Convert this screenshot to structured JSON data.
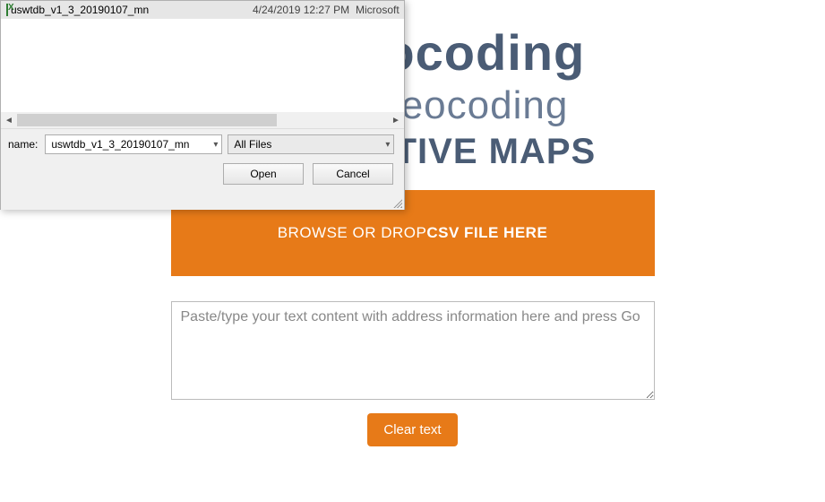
{
  "page": {
    "title": "ch Geocoding",
    "subtitle": "verse Geocoding",
    "tagline": "INTERACTIVE MAPS",
    "dropzone_prefix": "BROWSE OR DROP ",
    "dropzone_bold": "CSV FILE HERE",
    "textarea_placeholder": "Paste/type your text content with address information here and press Go",
    "clear_label": "Clear text"
  },
  "dialog": {
    "file": {
      "name": "uswtdb_v1_3_20190107_mn",
      "date": "4/24/2019 12:27 PM",
      "type": "Microsoft"
    },
    "filename_label": "name:",
    "filename_value": "uswtdb_v1_3_20190107_mn",
    "filter_value": "All Files",
    "open_label": "Open",
    "cancel_label": "Cancel"
  }
}
